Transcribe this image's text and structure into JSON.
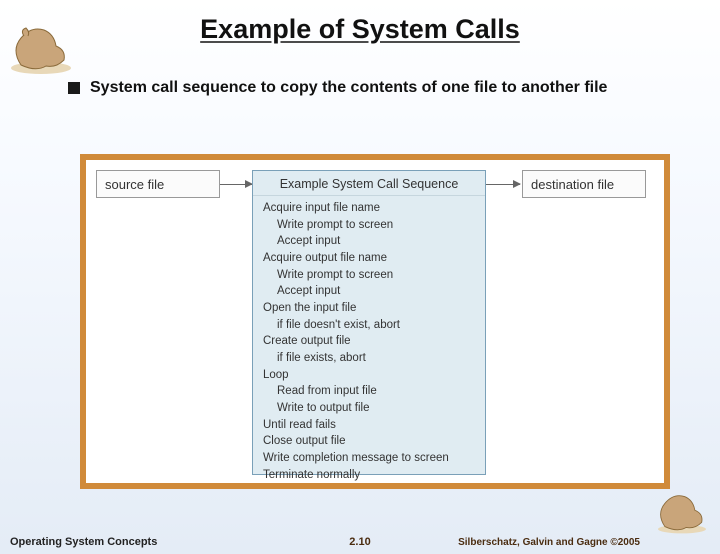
{
  "title": "Example of System Calls",
  "bullet": "System call sequence to copy the contents of one file to another file",
  "figure": {
    "source_label": "source file",
    "dest_label": "destination file",
    "seq_title": "Example System Call Sequence",
    "steps": {
      "s1": "Acquire input file name",
      "s2": "Write prompt to screen",
      "s3": "Accept input",
      "s4": "Acquire output file name",
      "s5": "Write prompt to screen",
      "s6": "Accept input",
      "s7": "Open the input file",
      "s8": "if file doesn't exist, abort",
      "s9": "Create output file",
      "s10": "if file exists, abort",
      "s11": "Loop",
      "s12": "Read from input file",
      "s13": "Write to output file",
      "s14": "Until read fails",
      "s15": "Close output file",
      "s16": "Write completion message to screen",
      "s17": "Terminate normally"
    }
  },
  "footer": {
    "left": "Operating System Concepts",
    "mid": "2.10",
    "right": "Silberschatz, Galvin and Gagne ©2005"
  }
}
